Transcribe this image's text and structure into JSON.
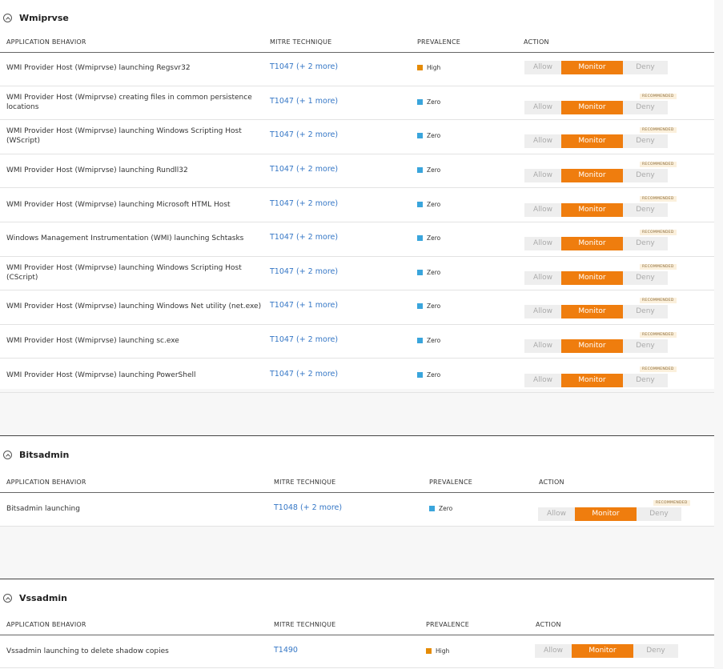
{
  "headers": {
    "behavior": "APPLICATION BEHAVIOR",
    "mitre": "MITRE TECHNIQUE",
    "prevalence": "PREVALENCE",
    "action": "ACTION"
  },
  "actions": {
    "allow": "Allow",
    "monitor": "Monitor",
    "deny": "Deny",
    "recommended": "RECOMMENDED"
  },
  "colors": {
    "high": "#e58b06",
    "zero": "#3aa5dc",
    "monitor": "#ef7d0e",
    "link": "#3577c6"
  },
  "sections": [
    {
      "title": "Wmiprvse",
      "rows": [
        {
          "behavior": "WMI Provider Host (Wmiprvse) launching Regsvr32",
          "mitre": "T1047 (+ 2 more)",
          "prevalence": "High",
          "selected": "Monitor",
          "recommended": false
        },
        {
          "behavior": "WMI Provider Host (Wmiprvse) creating files in common persistence locations",
          "mitre": "T1047 (+ 1 more)",
          "prevalence": "Zero",
          "selected": "Monitor",
          "recommended": true
        },
        {
          "behavior": "WMI Provider Host (Wmiprvse) launching Windows Scripting Host (WScript)",
          "mitre": "T1047 (+ 2 more)",
          "prevalence": "Zero",
          "selected": "Monitor",
          "recommended": true
        },
        {
          "behavior": "WMI Provider Host (Wmiprvse) launching Rundll32",
          "mitre": "T1047 (+ 2 more)",
          "prevalence": "Zero",
          "selected": "Monitor",
          "recommended": true
        },
        {
          "behavior": "WMI Provider Host (Wmiprvse) launching Microsoft HTML Host",
          "mitre": "T1047 (+ 2 more)",
          "prevalence": "Zero",
          "selected": "Monitor",
          "recommended": true
        },
        {
          "behavior": "Windows Management Instrumentation (WMI) launching Schtasks",
          "mitre": "T1047 (+ 2 more)",
          "prevalence": "Zero",
          "selected": "Monitor",
          "recommended": true
        },
        {
          "behavior": "WMI Provider Host (Wmiprvse) launching Windows Scripting Host (CScript)",
          "mitre": "T1047 (+ 2 more)",
          "prevalence": "Zero",
          "selected": "Monitor",
          "recommended": true
        },
        {
          "behavior": "WMI Provider Host (Wmiprvse) launching Windows Net utility (net.exe)",
          "mitre": "T1047 (+ 1 more)",
          "prevalence": "Zero",
          "selected": "Monitor",
          "recommended": true
        },
        {
          "behavior": "WMI Provider Host (Wmiprvse) launching sc.exe",
          "mitre": "T1047 (+ 2 more)",
          "prevalence": "Zero",
          "selected": "Monitor",
          "recommended": true
        },
        {
          "behavior": "WMI Provider Host (Wmiprvse) launching PowerShell",
          "mitre": "T1047 (+ 2 more)",
          "prevalence": "Zero",
          "selected": "Monitor",
          "recommended": true
        }
      ]
    },
    {
      "title": "Bitsadmin",
      "rows": [
        {
          "behavior": "Bitsadmin launching",
          "mitre": "T1048 (+ 2 more)",
          "prevalence": "Zero",
          "selected": "Monitor",
          "recommended": true
        }
      ]
    },
    {
      "title": "Vssadmin",
      "rows": [
        {
          "behavior": "Vssadmin launching to delete shadow copies",
          "mitre": "T1490",
          "prevalence": "High",
          "selected": "Monitor",
          "recommended": false
        }
      ]
    }
  ]
}
